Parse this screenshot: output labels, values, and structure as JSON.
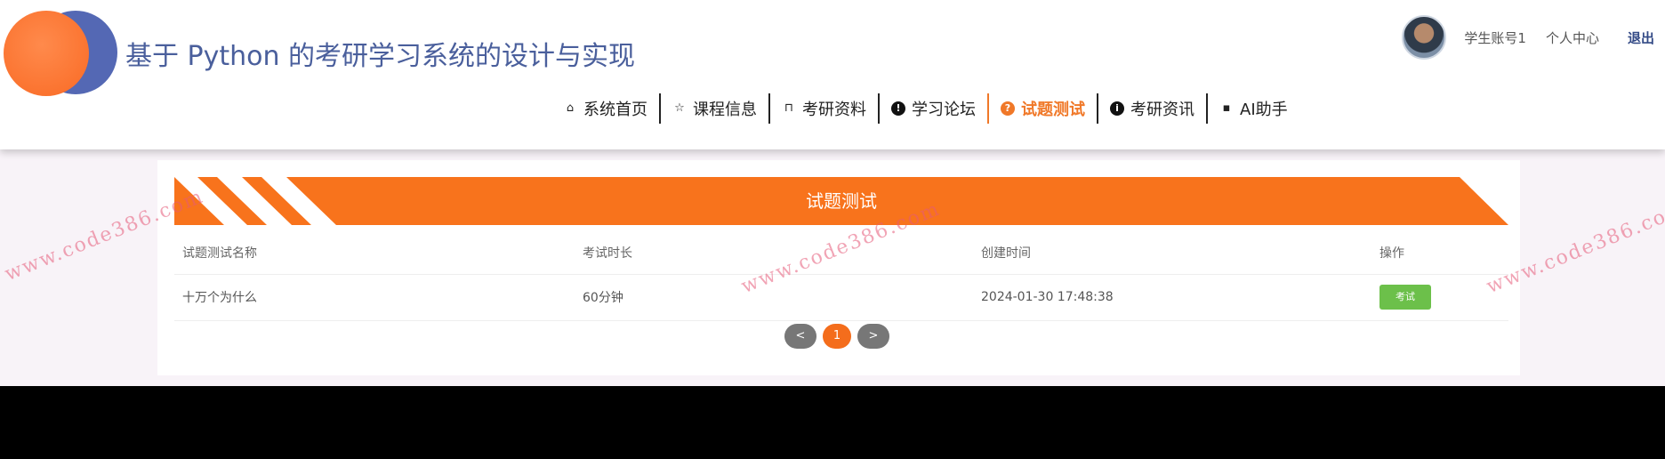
{
  "site": {
    "title": "基于 Python 的考研学习系统的设计与实现"
  },
  "user": {
    "account": "学生账号1",
    "center": "个人中心",
    "logout": "退出"
  },
  "nav": [
    {
      "label": "系统首页",
      "icon": "home-icon",
      "glyph": "⌂"
    },
    {
      "label": "课程信息",
      "icon": "star-icon",
      "glyph": "☆"
    },
    {
      "label": "考研资料",
      "icon": "bag-icon",
      "glyph": "⊓"
    },
    {
      "label": "学习论坛",
      "icon": "alert-icon",
      "glyph": "!"
    },
    {
      "label": "试题测试",
      "icon": "question-icon",
      "glyph": "?"
    },
    {
      "label": "考研资讯",
      "icon": "info-icon",
      "glyph": "i"
    },
    {
      "label": "AI助手",
      "icon": "chat-icon",
      "glyph": "▪"
    }
  ],
  "panel": {
    "title": "试题测试",
    "columns": [
      "试题测试名称",
      "考试时长",
      "创建时间",
      "操作"
    ],
    "rows": [
      {
        "name": "十万个为什么",
        "duration": "60分钟",
        "created": "2024-01-30 17:48:38",
        "action": "考试"
      }
    ]
  },
  "pagination": {
    "prev": "<",
    "current": "1",
    "next": ">"
  },
  "watermark": "www.code386.com",
  "colors": {
    "accent": "#f07828",
    "title_blue": "#4a5f9c",
    "exam_button": "#6cc04a"
  }
}
